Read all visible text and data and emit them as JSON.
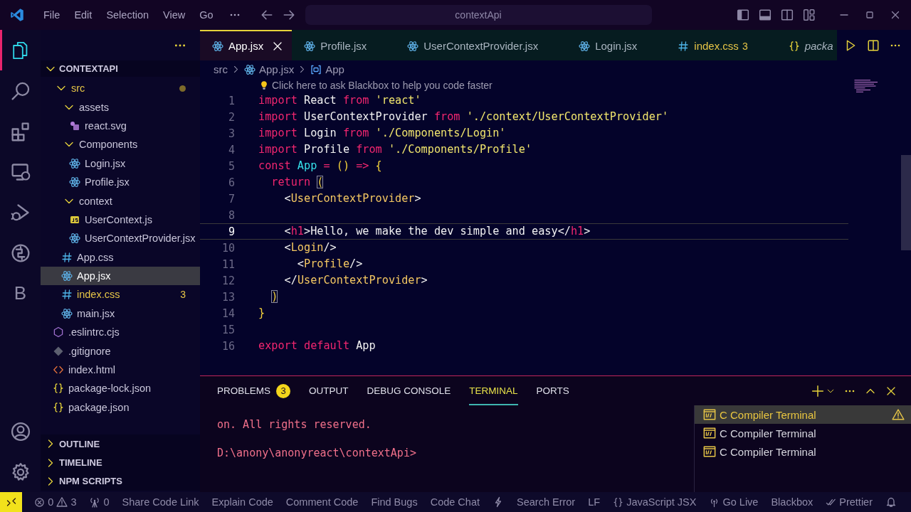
{
  "title_bar": {
    "menu": [
      "File",
      "Edit",
      "Selection",
      "View",
      "Go"
    ],
    "search": "contextApi"
  },
  "activity_bar": [
    {
      "kind": "files",
      "selected": true
    },
    {
      "kind": "search",
      "selected": false
    },
    {
      "kind": "extensions",
      "selected": false
    },
    {
      "kind": "remote",
      "selected": false
    },
    {
      "kind": "debug",
      "selected": false
    },
    {
      "kind": "globe",
      "selected": false
    },
    {
      "kind": "letter",
      "label": "B",
      "selected": false
    },
    {
      "kind": "account",
      "selected": false
    },
    {
      "kind": "settings",
      "selected": false
    }
  ],
  "explorer": {
    "folder": "CONTEXTAPI",
    "tree": [
      {
        "label": "src",
        "kind": "folder",
        "expanded": true,
        "modified": true,
        "warning": true,
        "selected": false,
        "children": [
          {
            "label": "assets",
            "kind": "folder",
            "expanded": true,
            "warning": false,
            "selected": false,
            "children": [
              {
                "label": "react.svg",
                "kind": "svg",
                "warning": false,
                "selected": false
              }
            ]
          },
          {
            "label": "Components",
            "kind": "folder",
            "expanded": true,
            "warning": false,
            "selected": false,
            "children": [
              {
                "label": "Login.jsx",
                "kind": "react",
                "warning": false,
                "selected": false
              },
              {
                "label": "Profile.jsx",
                "kind": "react",
                "warning": false,
                "selected": false
              }
            ]
          },
          {
            "label": "context",
            "kind": "folder",
            "expanded": true,
            "warning": false,
            "selected": false,
            "children": [
              {
                "label": "UserContext.js",
                "kind": "js",
                "warning": false,
                "selected": false
              },
              {
                "label": "UserContextProvider.jsx",
                "kind": "react",
                "warning": false,
                "selected": false
              }
            ]
          },
          {
            "label": "App.css",
            "kind": "css",
            "warning": false,
            "selected": false
          },
          {
            "label": "App.jsx",
            "kind": "react",
            "warning": false,
            "selected": true
          },
          {
            "label": "index.css",
            "kind": "css",
            "warning": true,
            "badge": "3",
            "selected": false
          },
          {
            "label": "main.jsx",
            "kind": "react",
            "warning": false,
            "selected": false
          }
        ]
      },
      {
        "label": ".eslintrc.cjs",
        "kind": "eslint",
        "warning": false,
        "selected": false
      },
      {
        "label": ".gitignore",
        "kind": "git",
        "warning": false,
        "selected": false
      },
      {
        "label": "index.html",
        "kind": "html",
        "warning": false,
        "selected": false
      },
      {
        "label": "package-lock.json",
        "kind": "json",
        "warning": false,
        "selected": false
      },
      {
        "label": "package.json",
        "kind": "json",
        "warning": false,
        "selected": false
      }
    ],
    "sections": [
      {
        "label": "OUTLINE",
        "expanded": false
      },
      {
        "label": "TIMELINE",
        "expanded": false
      },
      {
        "label": "NPM SCRIPTS",
        "expanded": false
      }
    ]
  },
  "tabs": [
    {
      "label": "App.jsx",
      "kind": "react",
      "selected": true,
      "warning": false,
      "preview": false
    },
    {
      "label": "Profile.jsx",
      "kind": "react",
      "selected": false,
      "warning": false,
      "preview": false
    },
    {
      "label": "UserContextProvider.jsx",
      "kind": "react",
      "selected": false,
      "warning": false,
      "preview": false
    },
    {
      "label": "Login.jsx",
      "kind": "react",
      "selected": false,
      "warning": false,
      "preview": false
    },
    {
      "label": "index.css",
      "kind": "css",
      "selected": false,
      "warning": true,
      "badge": "3",
      "preview": false
    },
    {
      "label": "packa",
      "kind": "json",
      "selected": false,
      "warning": false,
      "preview": true
    }
  ],
  "breadcrumb": [
    {
      "label": "src",
      "kind": "folder"
    },
    {
      "label": "App.jsx",
      "kind": "react"
    },
    {
      "label": "App",
      "kind": "symbol"
    }
  ],
  "codelens": "Click here to ask Blackbox to help you code faster",
  "lines": [
    {
      "number": "1",
      "current": false,
      "tokens": [
        {
          "kind": "k",
          "text": "import"
        },
        {
          "kind": "t",
          "text": " React "
        },
        {
          "kind": "k",
          "text": "from"
        },
        {
          "kind": "s",
          "text": " 'react'"
        }
      ]
    },
    {
      "number": "2",
      "current": false,
      "tokens": [
        {
          "kind": "k",
          "text": "import"
        },
        {
          "kind": "t",
          "text": " UserContextProvider "
        },
        {
          "kind": "k",
          "text": "from"
        },
        {
          "kind": "s",
          "text": " './context/UserContextProvider'"
        }
      ]
    },
    {
      "number": "3",
      "current": false,
      "tokens": [
        {
          "kind": "k",
          "text": "import"
        },
        {
          "kind": "t",
          "text": " Login "
        },
        {
          "kind": "k",
          "text": "from"
        },
        {
          "kind": "s",
          "text": " './Components/Login'"
        }
      ]
    },
    {
      "number": "4",
      "current": false,
      "tokens": [
        {
          "kind": "k",
          "text": "import"
        },
        {
          "kind": "t",
          "text": " Profile "
        },
        {
          "kind": "k",
          "text": "from"
        },
        {
          "kind": "s",
          "text": " './Components/Profile'"
        }
      ]
    },
    {
      "number": "5",
      "current": false,
      "tokens": [
        {
          "kind": "k",
          "text": "const"
        },
        {
          "kind": "f",
          "text": " App"
        },
        {
          "kind": "k",
          "text": " ="
        },
        {
          "kind": "p",
          "text": " ()"
        },
        {
          "kind": "k",
          "text": " =>"
        },
        {
          "kind": "p",
          "text": " {"
        }
      ]
    },
    {
      "number": "6",
      "current": false,
      "tokens": [
        {
          "kind": "k",
          "text": "  return"
        },
        {
          "kind": "b",
          "text": " ("
        }
      ]
    },
    {
      "number": "7",
      "current": false,
      "tokens": [
        {
          "kind": "m",
          "text": "    <"
        },
        {
          "kind": "g",
          "text": "UserContextProvider"
        },
        {
          "kind": "m",
          "text": ">"
        }
      ]
    },
    {
      "number": "8",
      "current": false
    },
    {
      "number": "9",
      "current": true,
      "tokens": [
        {
          "kind": "m",
          "text": "    <"
        },
        {
          "kind": "k",
          "text": "h1"
        },
        {
          "kind": "m",
          "text": ">"
        },
        {
          "kind": "t",
          "text": "Hello, we make the dev simple and easy"
        },
        {
          "kind": "m",
          "text": "</"
        },
        {
          "kind": "k",
          "text": "h1"
        },
        {
          "kind": "m",
          "text": ">"
        }
      ]
    },
    {
      "number": "10",
      "current": false,
      "tokens": [
        {
          "kind": "m",
          "text": "    <"
        },
        {
          "kind": "g",
          "text": "Login"
        },
        {
          "kind": "m",
          "text": "/>"
        }
      ]
    },
    {
      "number": "11",
      "current": false,
      "tokens": [
        {
          "kind": "m",
          "text": "      <"
        },
        {
          "kind": "g",
          "text": "Profile"
        },
        {
          "kind": "m",
          "text": "/>"
        }
      ]
    },
    {
      "number": "12",
      "current": false,
      "tokens": [
        {
          "kind": "m",
          "text": "    </"
        },
        {
          "kind": "g",
          "text": "UserContextProvider"
        },
        {
          "kind": "m",
          "text": ">"
        }
      ]
    },
    {
      "number": "13",
      "current": false,
      "tokens": [
        {
          "kind": "b",
          "text": "  )"
        }
      ]
    },
    {
      "number": "14",
      "current": false,
      "tokens": [
        {
          "kind": "p",
          "text": "}"
        }
      ]
    },
    {
      "number": "15",
      "current": false
    },
    {
      "number": "16",
      "current": false,
      "tokens": [
        {
          "kind": "k",
          "text": "export"
        },
        {
          "kind": "k",
          "text": " default"
        },
        {
          "kind": "t",
          "text": " App"
        }
      ]
    }
  ],
  "panel": {
    "tabs": [
      {
        "label": "PROBLEMS",
        "badge": "3",
        "selected": false
      },
      {
        "label": "OUTPUT",
        "selected": false
      },
      {
        "label": "DEBUG CONSOLE",
        "selected": false
      },
      {
        "label": "TERMINAL",
        "selected": true
      },
      {
        "label": "PORTS",
        "selected": false
      }
    ],
    "terminal_output": [
      "on. All rights reserved.",
      "D:\\anony\\anonyreact\\contextApi>"
    ],
    "terminals": [
      {
        "label": "C Compiler Terminal",
        "selected": true,
        "warning": true
      },
      {
        "label": "C Compiler Terminal",
        "selected": false,
        "warning": false
      },
      {
        "label": "C Compiler Terminal",
        "selected": false,
        "warning": false
      }
    ]
  },
  "status_bar": {
    "left": [
      {
        "kind": "remote"
      },
      {
        "kind": "problems",
        "errors": "0",
        "warnings": "3"
      },
      {
        "kind": "ports",
        "label": "0"
      },
      {
        "kind": "text",
        "label": "Share Code Link"
      },
      {
        "kind": "text",
        "label": "Explain Code"
      },
      {
        "kind": "text",
        "label": "Comment Code"
      },
      {
        "kind": "text",
        "label": "Find Bugs"
      },
      {
        "kind": "text",
        "label": "Code Chat"
      },
      {
        "kind": "bolt"
      },
      {
        "kind": "text",
        "label": "Search Error"
      }
    ],
    "right": [
      {
        "kind": "text",
        "label": "LF"
      },
      {
        "kind": "braces",
        "label": "JavaScript JSX"
      },
      {
        "kind": "broadcast",
        "label": "Go Live"
      },
      {
        "kind": "text",
        "label": "Blackbox"
      },
      {
        "kind": "checks",
        "label": "Prettier"
      },
      {
        "kind": "bell"
      }
    ]
  }
}
